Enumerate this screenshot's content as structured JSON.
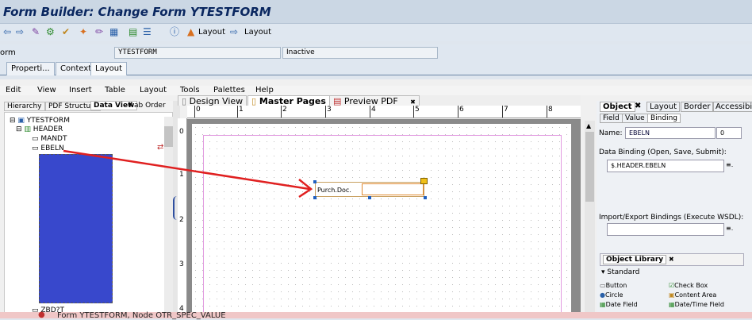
{
  "window": {
    "title": "Form Builder: Change Form YTESTFORM"
  },
  "toolbar": {
    "layout_btn_1": "Layout",
    "layout_btn_2": "Layout"
  },
  "form_row": {
    "label": "orm",
    "form_name": "YTESTFORM",
    "status": "Inactive"
  },
  "screen_tabs": [
    "Properti...",
    "Context",
    "Layout"
  ],
  "menu": [
    "Edit",
    "View",
    "Insert",
    "Table",
    "Layout",
    "Tools",
    "Palettes",
    "Help"
  ],
  "left_tabs": {
    "hierarchy": "Hierarchy",
    "pdf_structure": "PDF Structure",
    "data_view": "Data View",
    "tab_order": "ab Order"
  },
  "tree": {
    "root": "YTESTFORM",
    "header": "HEADER",
    "mandt": "MANDT",
    "ebeln": "EBELN",
    "bottom": "ZBD?T"
  },
  "doc_tabs": {
    "design": "Design View",
    "master": "Master Pages",
    "preview": "Preview PDF"
  },
  "ruler": {
    "h": [
      "0",
      "1",
      "2",
      "3",
      "4",
      "5",
      "6",
      "7",
      "8"
    ],
    "v": [
      "0",
      "1",
      "2",
      "3",
      "4"
    ]
  },
  "canvas_field": {
    "caption": "Purch.Doc."
  },
  "object_panel": {
    "tabs": [
      "Object",
      "Layout",
      "Border",
      "Accessibility"
    ],
    "subtabs": [
      "Field",
      "Value",
      "Binding"
    ],
    "name_label": "Name:",
    "name_value": "EBELN",
    "name_number": "0",
    "binding_label": "Data Binding (Open, Save, Submit):",
    "binding_value": "$.HEADER.EBELN",
    "ie_label": "Import/Export Bindings (Execute WSDL):"
  },
  "object_library": {
    "header": "Object Library",
    "group": "Standard",
    "items": [
      "Button",
      "Check Box",
      "Circle",
      "Content Area",
      "Date Field",
      "Date/Time Field"
    ]
  },
  "status": {
    "text": "Form YTESTFORM, Node OTR_SPEC_VALUE"
  },
  "colors": {
    "title": "#0a2760",
    "selection_fill": "#3848cc",
    "arrow": "#e02020",
    "status_bg": "#f0c7c7"
  }
}
